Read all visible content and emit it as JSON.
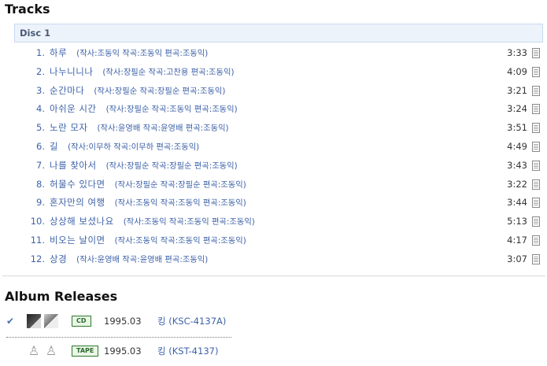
{
  "tracks_section": {
    "title": "Tracks",
    "disc_label": "Disc 1",
    "items": [
      {
        "num": "1.",
        "title": "하루",
        "credits": "(작사:조동익 작곡:조동익 편곡:조동익)",
        "time": "3:33"
      },
      {
        "num": "2.",
        "title": "나누니니나",
        "credits": "(작사:장필순 작곡:고찬용 편곡:조동익)",
        "time": "4:09"
      },
      {
        "num": "3.",
        "title": "순간마다",
        "credits": "(작사:장필순 작곡:장필순 편곡:조동익)",
        "time": "3:21"
      },
      {
        "num": "4.",
        "title": "아쉬운 시간",
        "credits": "(작사:장필순 작곡:조동익 편곡:조동익)",
        "time": "3:24"
      },
      {
        "num": "5.",
        "title": "노란 모자",
        "credits": "(작사:윤영배 작곡:윤영배 편곡:조동익)",
        "time": "3:51"
      },
      {
        "num": "6.",
        "title": "길",
        "credits": "(작사:이무하 작곡:이무하 편곡:조동익)",
        "time": "4:49"
      },
      {
        "num": "7.",
        "title": "나를 찾아서",
        "credits": "(작사:장필순 작곡:장필순 편곡:조동익)",
        "time": "3:43"
      },
      {
        "num": "8.",
        "title": "허물수 있다면",
        "credits": "(작사:장필순 작곡:장필순 편곡:조동익)",
        "time": "3:22"
      },
      {
        "num": "9.",
        "title": "혼자만의 여행",
        "credits": "(작사:조동익 작곡:조동익 편곡:조동익)",
        "time": "3:44"
      },
      {
        "num": "10.",
        "title": "상상해 보셨나요",
        "credits": "(작사:조동익 작곡:조동익 편곡:조동익)",
        "time": "5:13"
      },
      {
        "num": "11.",
        "title": "비오는 날이면",
        "credits": "(작사:조동익 작곡:조동익 편곡:조동익)",
        "time": "4:17"
      },
      {
        "num": "12.",
        "title": "상경",
        "credits": "(작사:윤영배 작곡:윤영배 편곡:조동익)",
        "time": "3:07"
      }
    ]
  },
  "releases_section": {
    "title": "Album Releases",
    "items": [
      {
        "checked": true,
        "format": "CD",
        "date": "1995.03",
        "label": "킹 (KSC-4137A)"
      },
      {
        "checked": false,
        "format": "TAPE",
        "date": "1995.03",
        "label": "킹 (KST-4137)"
      }
    ]
  },
  "icons": {
    "check": "check-icon",
    "lyrics": "lyrics-doc-icon",
    "cover_placeholder": "figure-icon"
  },
  "colors": {
    "link": "#3e62a8",
    "disc_header_bg": "#edf3fb",
    "format_badge": "#2d7a2d"
  }
}
